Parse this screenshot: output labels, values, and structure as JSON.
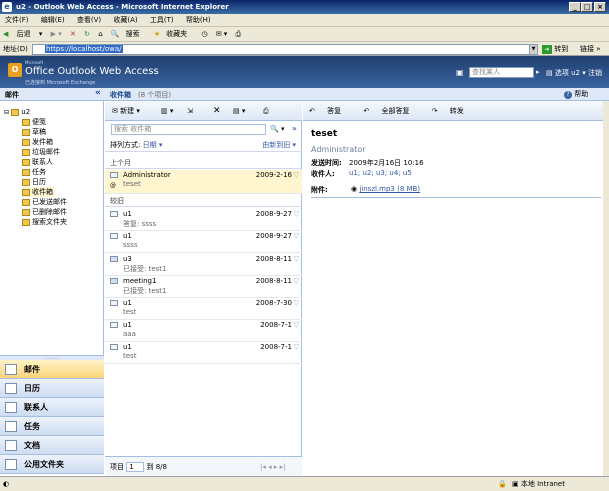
{
  "window": {
    "title": "u2 - Outlook Web Access - Microsoft Internet Explorer"
  },
  "menubar": [
    "文件(F)",
    "编辑(E)",
    "查看(V)",
    "收藏(A)",
    "工具(T)",
    "帮助(H)"
  ],
  "toolbar": {
    "back": "后退",
    "search": "搜索",
    "favorites": "收藏夹"
  },
  "address": {
    "label": "地址(D)",
    "url": "https://localhost/owa/",
    "go": "转到",
    "links": "链接 »"
  },
  "owa": {
    "ms_brand": "Microsoft",
    "product": "Office Outlook Web Access",
    "sub": "已连接到 Microsoft Exchange",
    "find_placeholder": "查找某人",
    "options": "选项",
    "user": "u2",
    "logoff": "注销",
    "help": "帮助"
  },
  "left": {
    "header": "邮件",
    "root": "u2",
    "folders": [
      "便笺",
      "草稿",
      "发件箱",
      "垃圾邮件",
      "联系人",
      "任务",
      "日历",
      "收件箱",
      "已发送邮件",
      "已删除邮件",
      "搜索文件夹"
    ],
    "nav": [
      "邮件",
      "日历",
      "联系人",
      "任务",
      "文档",
      "公用文件夹"
    ]
  },
  "middle": {
    "title": "收件箱",
    "count": "(8 个项目)",
    "new": "新建",
    "search_placeholder": "搜索 收件箱",
    "sort_label": "排列方式:",
    "sort_value": "日期",
    "sort_order": "由新到旧",
    "group1": "上个月",
    "group2": "较旧",
    "messages": [
      {
        "from": "Administrator",
        "preview": "teset",
        "date": "2009-2-16"
      },
      {
        "from": "u1",
        "preview": "答复: ssss",
        "date": "2008-9-27"
      },
      {
        "from": "u1",
        "preview": "ssss",
        "date": "2008-9-27"
      },
      {
        "from": "u3",
        "preview": "已接受: test1",
        "date": "2008-8-11"
      },
      {
        "from": "meeting1",
        "preview": "已接受: test1",
        "date": "2008-8-11"
      },
      {
        "from": "u1",
        "preview": "test",
        "date": "2008-7-30"
      },
      {
        "from": "u1",
        "preview": "aaa",
        "date": "2008-7-1"
      },
      {
        "from": "u1",
        "preview": "test",
        "date": "2008-7-1"
      }
    ],
    "footer_item": "项目",
    "footer_page": "1",
    "footer_of": "到 8/8"
  },
  "reading": {
    "reply": "答复",
    "reply_all": "全部答复",
    "forward": "转发",
    "subject": "teset",
    "sender": "Administrator",
    "sent_label": "发送时间:",
    "sent_value": "2009年2月16日 10:16",
    "to_label": "收件人:",
    "to_value": "u1; u2; u3; u4; u5",
    "attach_label": "附件:",
    "attach_value": "jinszl.mp3 (8 MB)"
  },
  "status": {
    "zone": "本地 Intranet"
  }
}
